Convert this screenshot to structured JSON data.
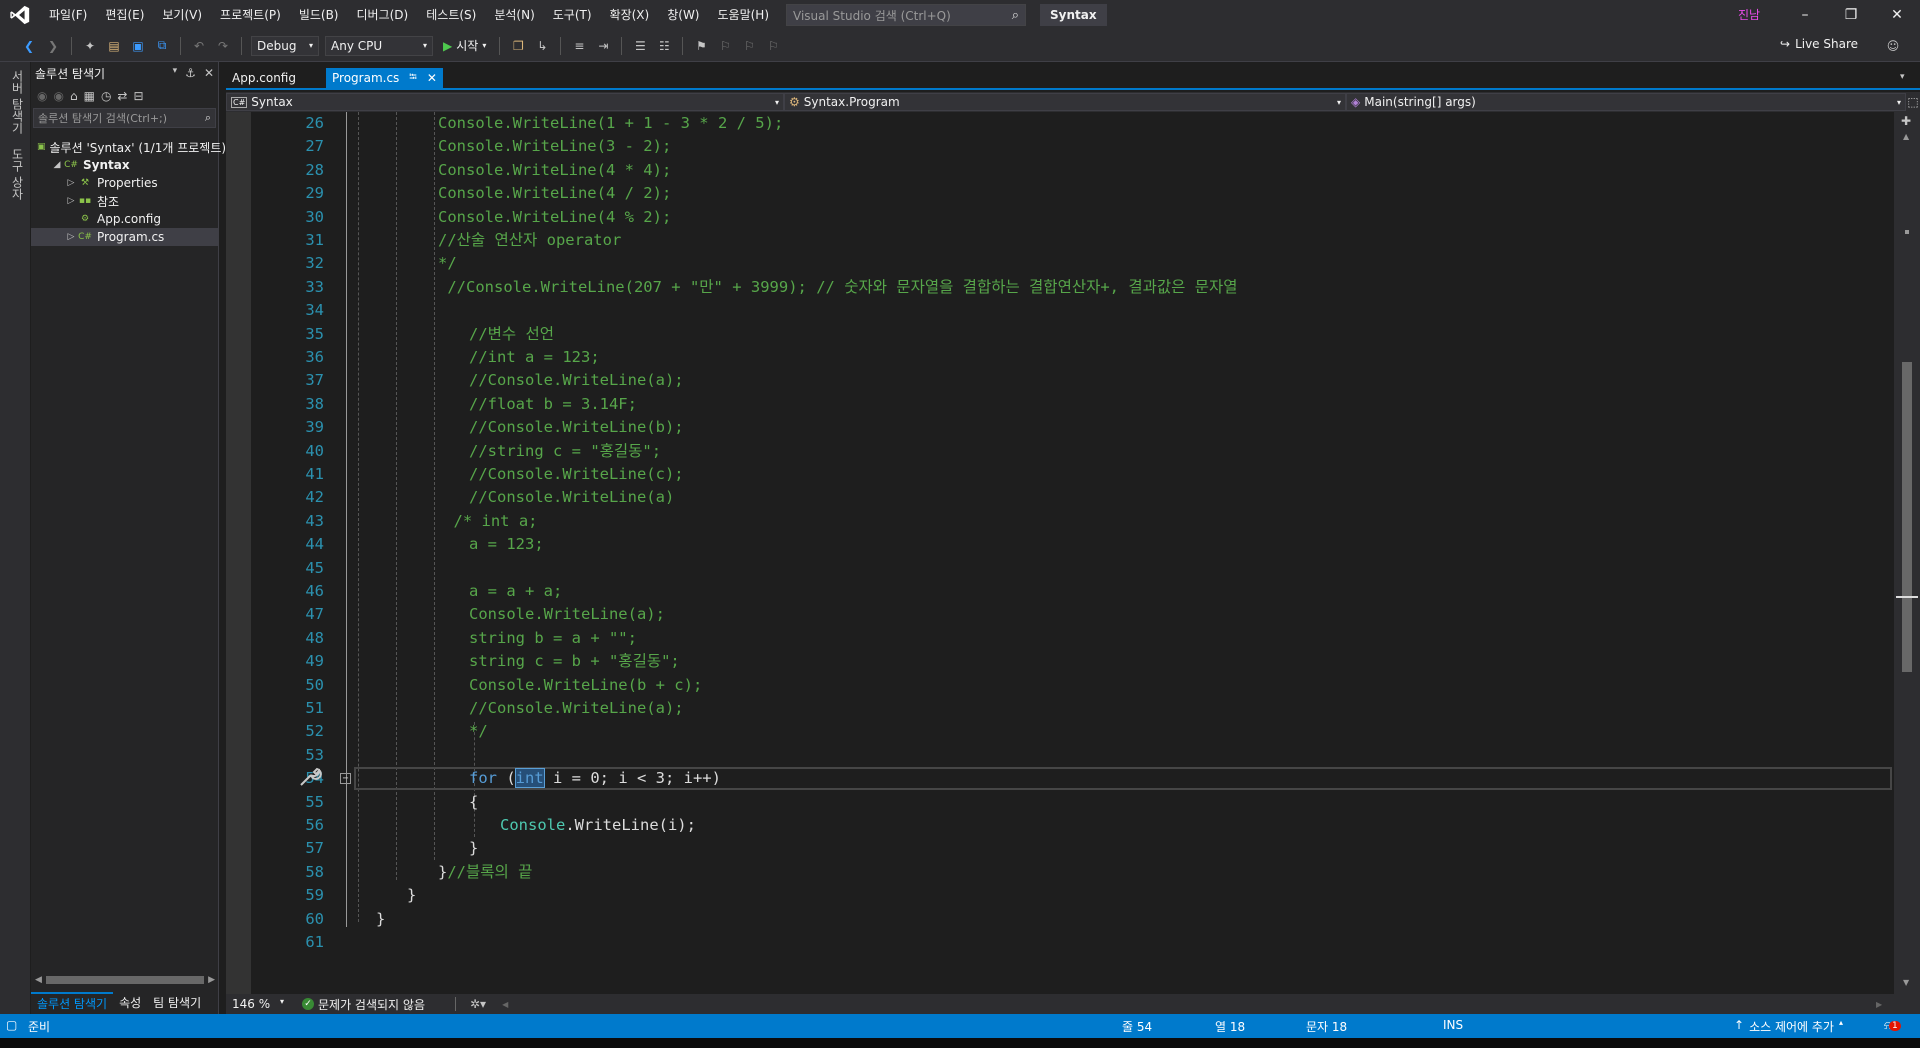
{
  "menu": [
    "파일(F)",
    "편집(E)",
    "보기(V)",
    "프로젝트(P)",
    "빌드(B)",
    "디버그(D)",
    "테스트(S)",
    "분석(N)",
    "도구(T)",
    "확장(X)",
    "창(W)",
    "도움말(H)"
  ],
  "search": {
    "placeholder": "Visual Studio 검색 (Ctrl+Q)"
  },
  "solution_title": "Syntax",
  "user": "진남",
  "toolbar": {
    "config": "Debug",
    "platform": "Any CPU",
    "start": "시작",
    "live_share": "Live Share"
  },
  "vtabs": {
    "server": "서버 탐색기",
    "toolbox": "도구 상자"
  },
  "solution_explorer": {
    "title": "솔루션 탐색기",
    "search_placeholder": "솔루션 탐색기 검색(Ctrl+;)",
    "tree": [
      {
        "label": "솔루션 'Syntax' (1/1개 프로젝트)",
        "icon": "solution-icon",
        "indent": 0,
        "arrow": "",
        "bold": false
      },
      {
        "label": "Syntax",
        "icon": "csharp-project-icon",
        "indent": 1,
        "arrow": "◢",
        "bold": true
      },
      {
        "label": "Properties",
        "icon": "wrench-icon",
        "indent": 2,
        "arrow": "▷",
        "bold": false
      },
      {
        "label": "참조",
        "icon": "references-icon",
        "indent": 2,
        "arrow": "▷",
        "bold": false
      },
      {
        "label": "App.config",
        "icon": "config-file-icon",
        "indent": 2,
        "arrow": "",
        "bold": false
      },
      {
        "label": "Program.cs",
        "icon": "csharp-file-icon",
        "indent": 2,
        "arrow": "▷",
        "bold": false
      }
    ],
    "bottom_tabs": [
      "솔루션 탐색기",
      "속성",
      "팀 탐색기"
    ]
  },
  "doc_tabs": [
    {
      "label": "App.config",
      "active": false
    },
    {
      "label": "Program.cs",
      "active": true
    }
  ],
  "nav": {
    "project": "Syntax",
    "type": "Syntax.Program",
    "member": "Main(string[] args)"
  },
  "editor": {
    "lines": [
      {
        "n": "26",
        "t": "Console.WriteLine(1 + 1 - 3 * 2 / 5);",
        "c": "comment",
        "x": 0
      },
      {
        "n": "27",
        "t": "Console.WriteLine(3 - 2);",
        "c": "comment",
        "x": 0
      },
      {
        "n": "28",
        "t": "Console.WriteLine(4 * 4);",
        "c": "comment",
        "x": 0
      },
      {
        "n": "29",
        "t": "Console.WriteLine(4 / 2);",
        "c": "comment",
        "x": 0
      },
      {
        "n": "30",
        "t": "Console.WriteLine(4 % 2);",
        "c": "comment",
        "x": 0
      },
      {
        "n": "31",
        "t": "//산술 연산자 operator",
        "c": "comment",
        "x": 0
      },
      {
        "n": "32",
        "t": "*/",
        "c": "comment",
        "x": 0
      },
      {
        "n": "33",
        "t": " //Console.WriteLine(207 + \"만\" + 3999); // 숫자와 문자열을 결합하는 결합연산자+, 결과값은 문자열",
        "c": "comment",
        "x": 0
      },
      {
        "n": "34",
        "t": "",
        "c": "plain",
        "x": 0
      },
      {
        "n": "35",
        "t": "//변수 선언",
        "c": "comment",
        "x": 1
      },
      {
        "n": "36",
        "t": "//int a = 123;",
        "c": "comment",
        "x": 1
      },
      {
        "n": "37",
        "t": "//Console.WriteLine(a);",
        "c": "comment",
        "x": 1
      },
      {
        "n": "38",
        "t": "//float b = 3.14F;",
        "c": "comment",
        "x": 1
      },
      {
        "n": "39",
        "t": "//Console.WriteLine(b);",
        "c": "comment",
        "x": 1
      },
      {
        "n": "40",
        "t": "//string c = \"홍길동\";",
        "c": "comment",
        "x": 1
      },
      {
        "n": "41",
        "t": "//Console.WriteLine(c);",
        "c": "comment",
        "x": 1
      },
      {
        "n": "42",
        "t": "//Console.WriteLine(a)",
        "c": "comment",
        "x": 1
      },
      {
        "n": "43",
        "t": "/* int a;",
        "c": "comment",
        "x": 0.5
      },
      {
        "n": "44",
        "t": "a = 123;",
        "c": "comment",
        "x": 1
      },
      {
        "n": "45",
        "t": "",
        "c": "plain",
        "x": 0
      },
      {
        "n": "46",
        "t": "a = a + a;",
        "c": "comment",
        "x": 1
      },
      {
        "n": "47",
        "t": "Console.WriteLine(a);",
        "c": "comment",
        "x": 1
      },
      {
        "n": "48",
        "t": "string b = a + \"\";",
        "c": "comment",
        "x": 1
      },
      {
        "n": "49",
        "t": "string c = b + \"홍길동\";",
        "c": "comment",
        "x": 1
      },
      {
        "n": "50",
        "t": "Console.WriteLine(b + c);",
        "c": "comment",
        "x": 1
      },
      {
        "n": "51",
        "t": "//Console.WriteLine(a);",
        "c": "comment",
        "x": 1
      },
      {
        "n": "52",
        "t": "*/",
        "c": "comment",
        "x": 1
      },
      {
        "n": "53",
        "t": "",
        "c": "plain",
        "x": 0
      },
      {
        "n": "54",
        "t": "",
        "c": "for",
        "x": 1
      },
      {
        "n": "55",
        "t": "{",
        "c": "plain",
        "x": 1
      },
      {
        "n": "56",
        "t": "",
        "c": "writeline",
        "x": 2
      },
      {
        "n": "57",
        "t": "}",
        "c": "plain",
        "x": 1
      },
      {
        "n": "58",
        "t": "",
        "c": "closeblock",
        "x": 0
      },
      {
        "n": "59",
        "t": "}",
        "c": "plain",
        "x": -1
      },
      {
        "n": "60",
        "t": "}",
        "c": "plain",
        "x": -2
      },
      {
        "n": "61",
        "t": "",
        "c": "plain",
        "x": 0
      }
    ],
    "for_line": {
      "kw": "for",
      "open": " (",
      "int": "int",
      "rest": " i = 0; i < 3; i++)"
    },
    "writeline_line": {
      "cls": "Console",
      "rest": ".WriteLine(i);"
    },
    "closeblock_line": {
      "brace": "}",
      "comment": "//블록의 끝"
    }
  },
  "editor_bottom": {
    "zoom": "146 %",
    "issues": "문제가 검색되지 않음"
  },
  "status": {
    "ready": "준비",
    "line": "줄 54",
    "col": "열 18",
    "char": "문자 18",
    "mode": "INS",
    "source_control": "소스 제어에 추가",
    "notifications": "1"
  },
  "colors": {
    "accent": "#007acc",
    "comment": "#57a64a",
    "keyword": "#569cd6",
    "type": "#4ec9b0",
    "line_number": "#2b91af"
  }
}
